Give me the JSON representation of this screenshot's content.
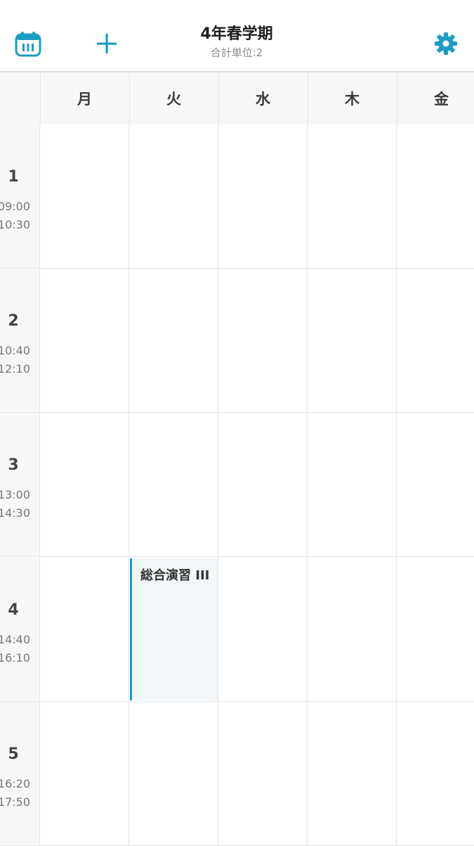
{
  "header": {
    "title": "4年春学期",
    "subtitle": "合計単位:2",
    "calendar_icon": "calendar-icon",
    "add_icon": "plus-icon",
    "settings_icon": "gear-icon",
    "accent_color": "#1a9cc4"
  },
  "days": [
    "月",
    "火",
    "水",
    "木",
    "金"
  ],
  "periods": [
    {
      "number": "1",
      "start": "09:00",
      "end": "10:30"
    },
    {
      "number": "2",
      "start": "10:40",
      "end": "12:10"
    },
    {
      "number": "3",
      "start": "13:00",
      "end": "14:30"
    },
    {
      "number": "4",
      "start": "14:40",
      "end": "16:10"
    },
    {
      "number": "5",
      "start": "16:20",
      "end": "17:50"
    }
  ],
  "courses": [
    {
      "name": "総合演習 III",
      "day": "火",
      "period": "4"
    }
  ]
}
